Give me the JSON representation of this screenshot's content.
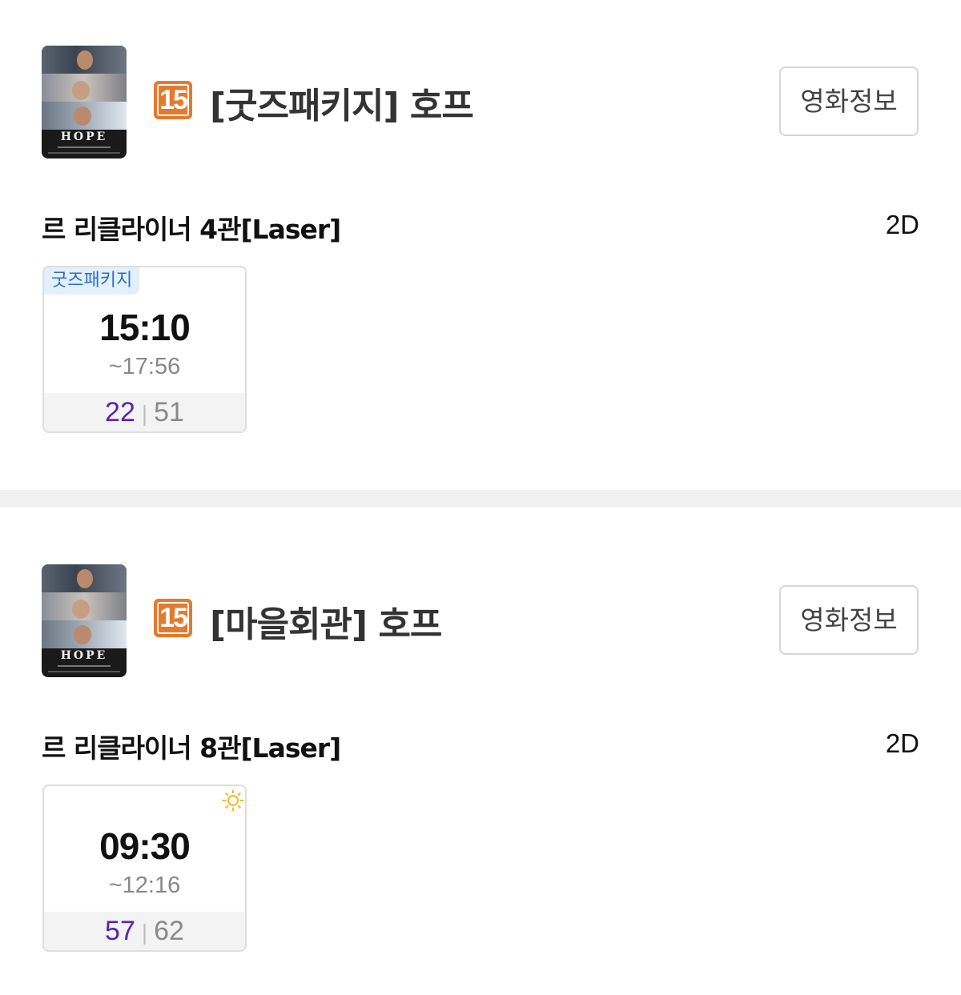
{
  "movies": [
    {
      "poster_title": "HOPE",
      "rating": "15",
      "title": "[굿즈패키지] 호프",
      "info_button": "영화정보",
      "hall": "르 리클라이너 4관[Laser]",
      "format": "2D",
      "showtime": {
        "tag": "굿즈패키지",
        "start": "15:10",
        "end": "~17:56",
        "seats_available": "22",
        "seats_separator": "|",
        "seats_total": "51"
      }
    },
    {
      "poster_title": "HOPE",
      "rating": "15",
      "title": "[마을회관] 호프",
      "info_button": "영화정보",
      "hall": "르 리클라이너 8관[Laser]",
      "format": "2D",
      "showtime": {
        "icon": "sun-icon",
        "start": "09:30",
        "end": "~12:16",
        "seats_available": "57",
        "seats_separator": "|",
        "seats_total": "62"
      }
    }
  ],
  "colors": {
    "rating_badge": "#e47a2e",
    "seats_available": "#5a23b0",
    "tag_background": "#e3effb",
    "tag_text": "#2b6fc4",
    "sun_icon": "#f2b824"
  }
}
